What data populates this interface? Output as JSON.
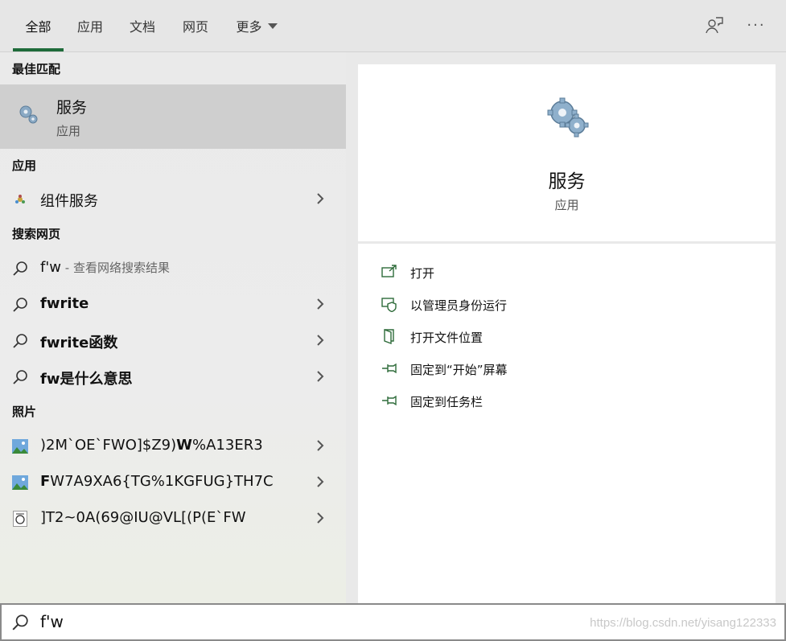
{
  "tabs": [
    {
      "label": "全部",
      "active": true
    },
    {
      "label": "应用"
    },
    {
      "label": "文档"
    },
    {
      "label": "网页"
    },
    {
      "label": "更多"
    }
  ],
  "sections": {
    "best_match": "最佳匹配",
    "apps": "应用",
    "web": "搜索网页",
    "photos": "照片"
  },
  "best_match": {
    "name": "服务",
    "type": "应用",
    "icon": "services-gear-icon"
  },
  "apps": [
    {
      "label": "组件服务",
      "icon": "component-services-icon"
    }
  ],
  "web": [
    {
      "label": "f'w",
      "hint": " - 查看网络搜索结果",
      "bold": false
    },
    {
      "label": "fwrite",
      "bold": true
    },
    {
      "label": "fwrite函数",
      "bold": true
    },
    {
      "label": "fw是什么意思",
      "bold": true
    }
  ],
  "photos": [
    {
      "prefix": ")2M`OE`FWO]$Z9)",
      "bold_char": "W",
      "suffix": "%A13ER3",
      "icon": "image-icon"
    },
    {
      "prefix": "",
      "bold_char": "F",
      "suffix": "W7A9XA6{TG%1KGFUG}TH7C",
      "icon": "image-icon"
    },
    {
      "prefix": "]T2~0A(69@IU@VL[(P(E`FW",
      "bold_char": "",
      "suffix": "",
      "icon": "document-image-icon"
    }
  ],
  "detail": {
    "name": "服务",
    "type": "应用",
    "actions": [
      {
        "label": "打开",
        "icon": "open-icon"
      },
      {
        "label": "以管理员身份运行",
        "icon": "run-as-admin-shield-icon"
      },
      {
        "label": "打开文件位置",
        "icon": "file-location-icon"
      },
      {
        "label": "固定到“开始”屏幕",
        "icon": "pin-icon"
      },
      {
        "label": "固定到任务栏",
        "icon": "pin-icon"
      }
    ]
  },
  "search": {
    "value": "f'w"
  },
  "watermark": "https://blog.csdn.net/yisang122333",
  "colors": {
    "accent": "#1f6b3a",
    "selected": "#cfcfcf",
    "panel": "#ffffff"
  }
}
